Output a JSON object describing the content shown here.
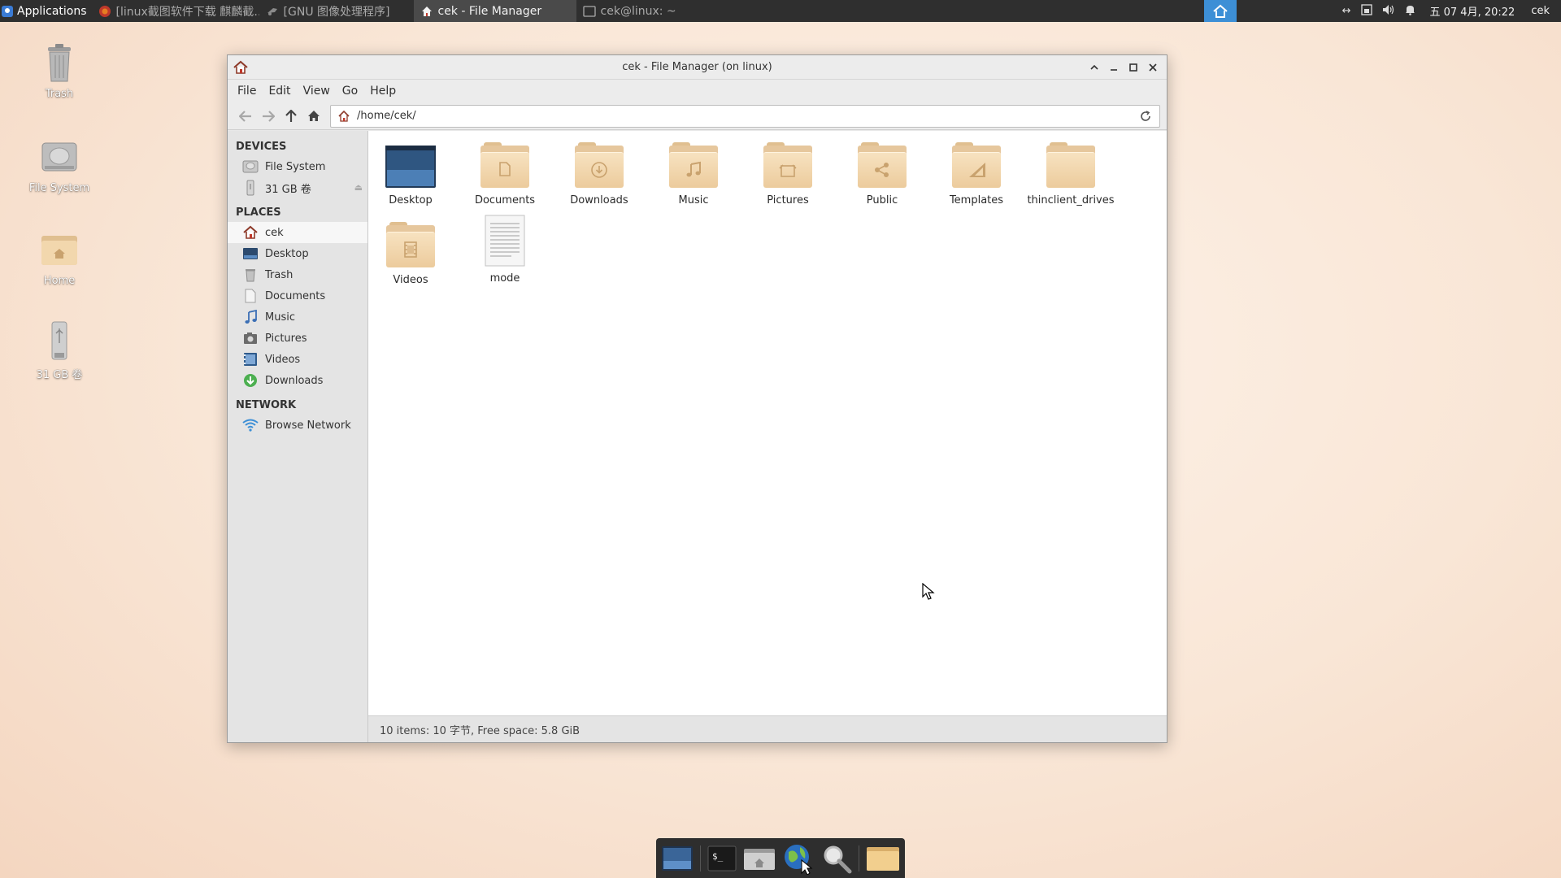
{
  "panel": {
    "applications_label": "Applications",
    "tasks": [
      {
        "label": "[linux截图软件下载 麒麟截…",
        "active": false
      },
      {
        "label": "[GNU 图像处理程序]",
        "active": false
      },
      {
        "label": "cek - File Manager",
        "active": true
      },
      {
        "label": "cek@linux: ~",
        "active": false
      }
    ],
    "clock": "五 07 4月, 20:22",
    "user": "cek"
  },
  "desktop_icons": [
    {
      "label": "Trash",
      "icon": "trash-icon"
    },
    {
      "label": "File System",
      "icon": "drive-icon"
    },
    {
      "label": "Home",
      "icon": "home-folder-icon"
    },
    {
      "label": "31 GB 卷",
      "icon": "usb-drive-icon"
    }
  ],
  "window": {
    "title": "cek - File Manager (on linux)",
    "menu": [
      "File",
      "Edit",
      "View",
      "Go",
      "Help"
    ],
    "address": "/home/cek/"
  },
  "sidebar": {
    "devices_header": "DEVICES",
    "devices": [
      {
        "label": "File System",
        "icon": "drive-icon"
      },
      {
        "label": "31 GB 卷",
        "icon": "usb-drive-icon"
      }
    ],
    "places_header": "PLACES",
    "places": [
      {
        "label": "cek",
        "icon": "home-icon",
        "selected": true
      },
      {
        "label": "Desktop",
        "icon": "desktop-icon"
      },
      {
        "label": "Trash",
        "icon": "trash-icon"
      },
      {
        "label": "Documents",
        "icon": "document-icon"
      },
      {
        "label": "Music",
        "icon": "music-icon"
      },
      {
        "label": "Pictures",
        "icon": "pictures-icon"
      },
      {
        "label": "Videos",
        "icon": "video-icon"
      },
      {
        "label": "Downloads",
        "icon": "download-icon"
      }
    ],
    "network_header": "NETWORK",
    "network": [
      {
        "label": "Browse Network",
        "icon": "network-icon"
      }
    ]
  },
  "files": [
    {
      "label": "Desktop",
      "icon": "desktop-folder-icon"
    },
    {
      "label": "Documents",
      "icon": "documents-folder-icon"
    },
    {
      "label": "Downloads",
      "icon": "downloads-folder-icon"
    },
    {
      "label": "Music",
      "icon": "music-folder-icon"
    },
    {
      "label": "Pictures",
      "icon": "pictures-folder-icon"
    },
    {
      "label": "Public",
      "icon": "public-folder-icon"
    },
    {
      "label": "Templates",
      "icon": "templates-folder-icon"
    },
    {
      "label": "thinclient_drives",
      "icon": "folder-icon"
    },
    {
      "label": "Videos",
      "icon": "videos-folder-icon"
    },
    {
      "label": "mode",
      "icon": "text-file-icon"
    }
  ],
  "status": "10 items: 10 字节, Free space: 5.8 GiB",
  "dock": [
    "desktop-icon",
    "terminal-icon",
    "home-folder-icon",
    "browser-icon",
    "search-icon",
    "folder-icon"
  ]
}
